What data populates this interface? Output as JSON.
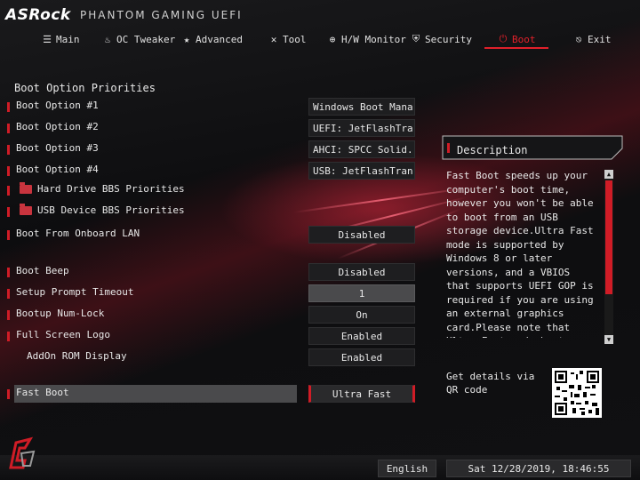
{
  "header": {
    "brand": "ASRock",
    "subtitle": "PHANTOM GAMING UEFI"
  },
  "tabs": [
    {
      "label": "Main",
      "icon": "list-icon"
    },
    {
      "label": "OC Tweaker",
      "icon": "flame-icon"
    },
    {
      "label": "Advanced",
      "icon": "star-icon"
    },
    {
      "label": "Tool",
      "icon": "tools-icon"
    },
    {
      "label": "H/W Monitor",
      "icon": "globe-icon"
    },
    {
      "label": "Security",
      "icon": "shield-icon"
    },
    {
      "label": "Boot",
      "icon": "power-icon",
      "active": true
    },
    {
      "label": "Exit",
      "icon": "exit-icon"
    }
  ],
  "accent_color": "#d01c26",
  "content": {
    "section_title": "Boot Option Priorities",
    "rows": [
      {
        "label": "Boot Option #1",
        "value": "Windows Boot Mana..."
      },
      {
        "label": "Boot Option #2",
        "value": "UEFI: JetFlashTra..."
      },
      {
        "label": "Boot Option #3",
        "value": "AHCI:  SPCC Solid..."
      },
      {
        "label": "Boot Option #4",
        "value": "USB: JetFlashTran..."
      },
      {
        "label": "Hard Drive BBS Priorities",
        "value": null
      },
      {
        "label": "USB Device BBS Priorities",
        "value": null
      },
      {
        "label": "Boot From Onboard LAN",
        "value": "Disabled"
      },
      {
        "label": "Boot Beep",
        "value": "Disabled"
      },
      {
        "label": "Setup Prompt Timeout",
        "value": "1"
      },
      {
        "label": "Bootup Num-Lock",
        "value": "On"
      },
      {
        "label": "Full Screen Logo",
        "value": "Enabled"
      },
      {
        "label": "AddOn ROM Display",
        "value": "Enabled"
      },
      {
        "label": "Fast Boot",
        "value": "Ultra Fast"
      }
    ]
  },
  "description": {
    "title": "Description",
    "text": "Fast Boot speeds up your computer's boot time, however you won't be able to boot from an USB storage device.Ultra Fast mode is supported by Windows 8 or later versions, and a VBIOS that supports UEFI GOP is required if you are using an external graphics card.Please note that Ultra Fast mode boots so fast that the only way to enter this",
    "qr_text": "Get details via QR code"
  },
  "footer": {
    "language": "English",
    "datetime": "Sat 12/28/2019, 18:46:55"
  }
}
